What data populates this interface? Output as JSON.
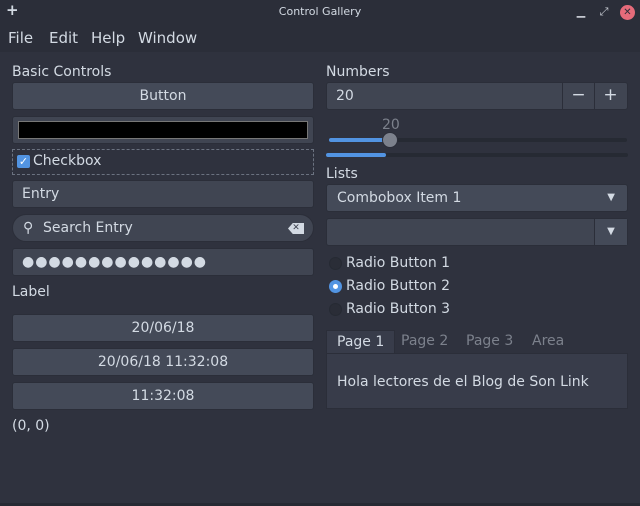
{
  "window": {
    "title": "Control Gallery",
    "new_icon": "+",
    "minimize": "▁",
    "maximize": "⤢",
    "close": "✕"
  },
  "menu": [
    "File",
    "Edit",
    "Help",
    "Window"
  ],
  "basic": {
    "heading": "Basic Controls",
    "button_label": "Button",
    "color_value": "#000000",
    "checkbox_label": "Checkbox",
    "checkbox_checked": true,
    "entry_value": "Entry",
    "search_placeholder": "Search Entry",
    "password_value": "●●●●●●●●●●●●●●",
    "label_text": "Label",
    "date_button": "20/06/18",
    "datetime_button": "20/06/18 11:32:08",
    "time_button": "11:32:08",
    "coords": "(0, 0)"
  },
  "numbers": {
    "heading": "Numbers",
    "spin_value": "20",
    "minus": "−",
    "plus": "+",
    "slider_value": "20",
    "slider_fraction": 0.2,
    "progress_fraction": 0.2
  },
  "lists": {
    "heading": "Lists",
    "combobox_selected": "Combobox Item 1",
    "editable_combobox_value": "",
    "radios": [
      {
        "label": "Radio Button 1",
        "checked": false
      },
      {
        "label": "Radio Button 2",
        "checked": true
      },
      {
        "label": "Radio Button 3",
        "checked": false
      }
    ],
    "tabs": [
      "Page 1",
      "Page 2",
      "Page 3",
      "Area"
    ],
    "active_tab": "Page 1",
    "tab_content": "Hola lectores de el Blog de Son Link"
  },
  "icons": {
    "search": "search-icon",
    "clear": "clear-icon",
    "check": "check-icon",
    "dropdown": "chevron-down-icon"
  },
  "colors": {
    "background": "#2f323e",
    "accent": "#5294e2",
    "close_button": "#e56b7a",
    "text": "#d3dae3"
  }
}
